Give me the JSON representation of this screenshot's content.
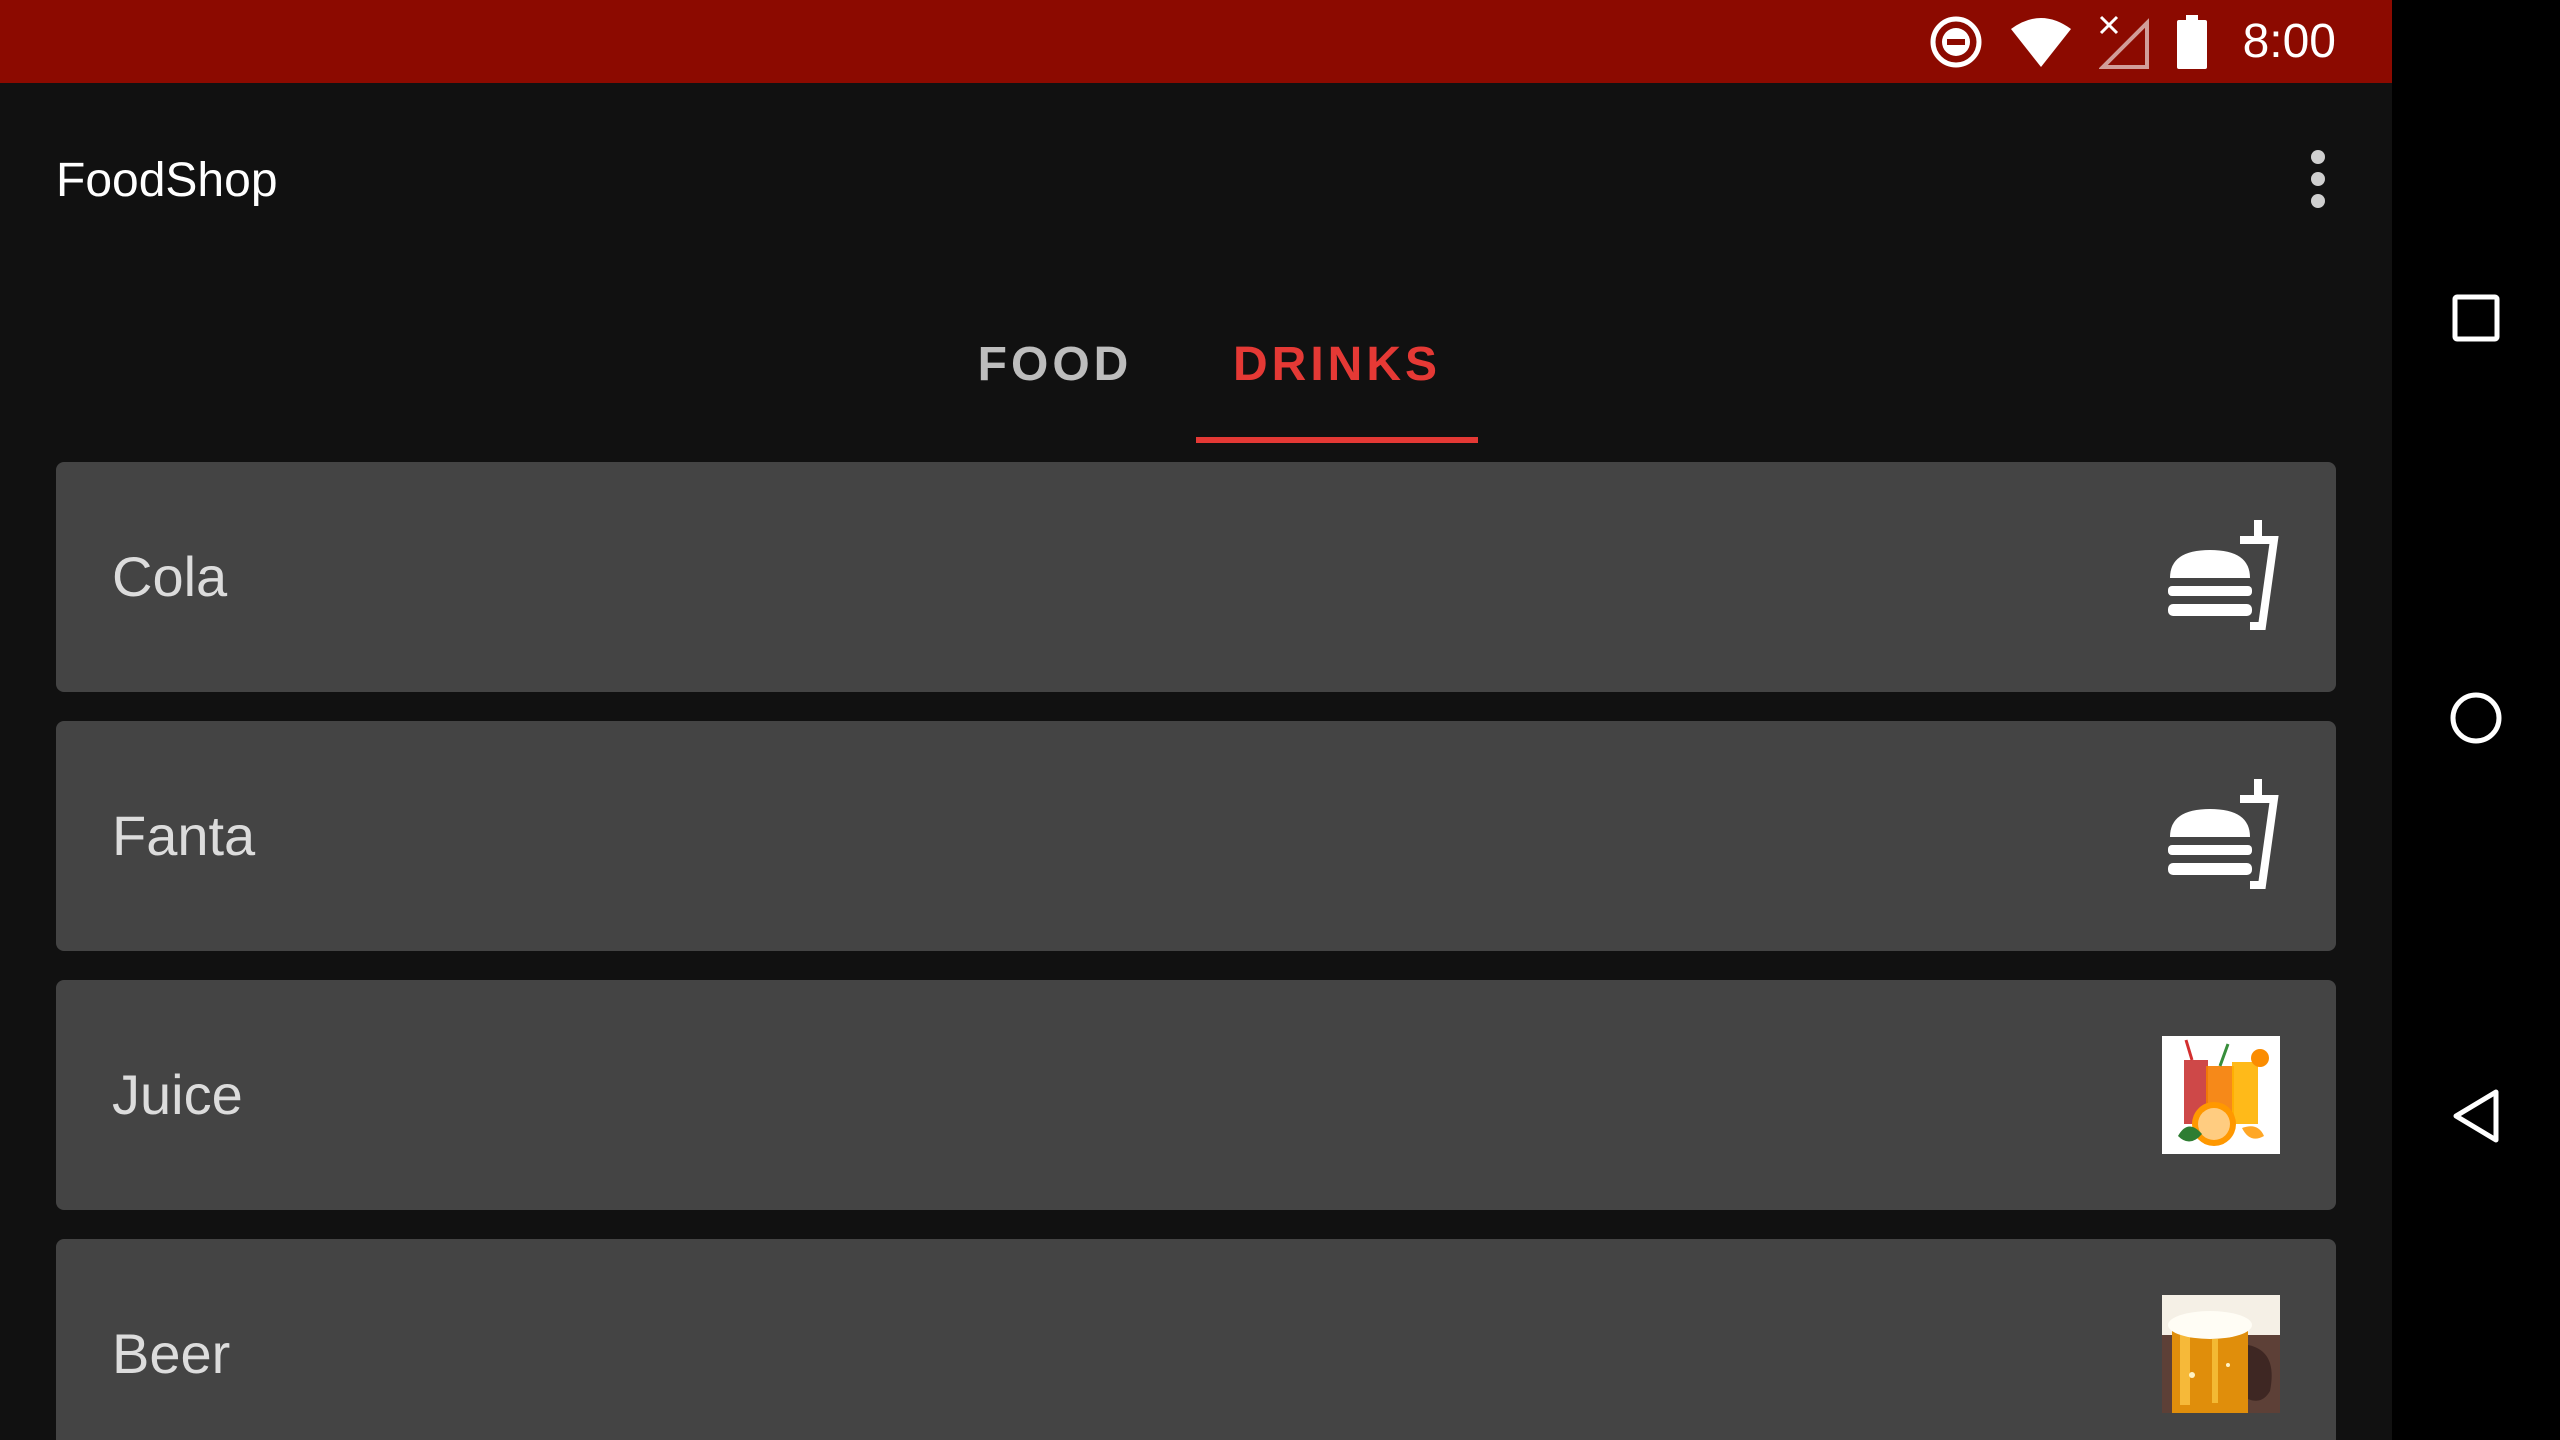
{
  "status_bar": {
    "time": "8:00",
    "icons": [
      "do-not-disturb-icon",
      "wifi-icon",
      "no-signal-icon",
      "battery-icon"
    ]
  },
  "app_bar": {
    "title": "FoodShop",
    "overflow_icon": "more-vert-icon"
  },
  "tabs": [
    {
      "label": "FOOD",
      "selected": false
    },
    {
      "label": "DRINKS",
      "selected": true
    }
  ],
  "items": [
    {
      "label": "Cola",
      "icon": "fastfood-icon"
    },
    {
      "label": "Fanta",
      "icon": "fastfood-icon"
    },
    {
      "label": "Juice",
      "icon": "juice-image"
    },
    {
      "label": "Beer",
      "icon": "beer-image"
    }
  ],
  "nav_bar": {
    "icons": [
      "recents-icon",
      "home-icon",
      "back-icon"
    ]
  },
  "colors": {
    "status_bar": "#8c0a00",
    "background": "#111111",
    "card": "#444444",
    "accent": "#e53935",
    "tab_inactive": "#bdbdbd"
  }
}
